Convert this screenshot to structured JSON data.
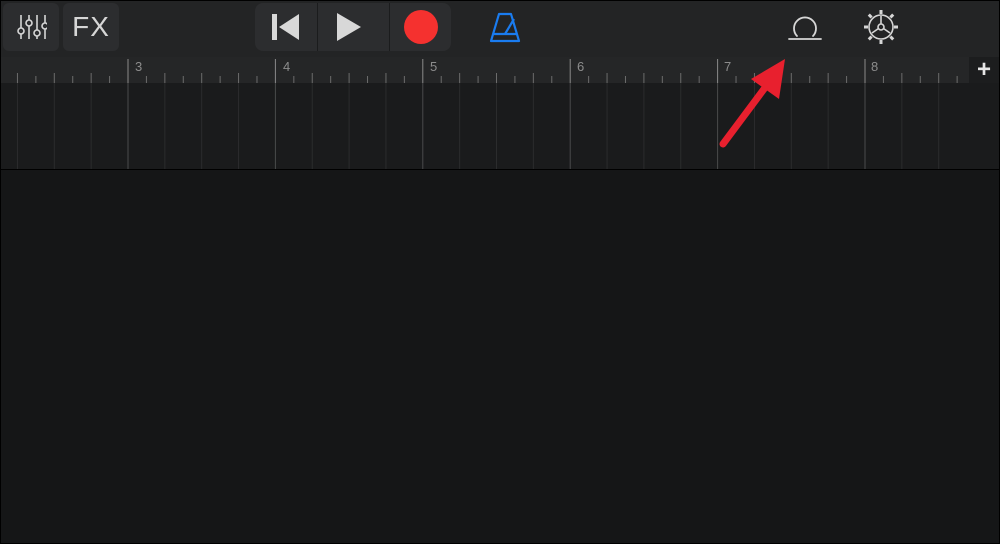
{
  "toolbar": {
    "mixer_icon": "mixer-sliders-icon",
    "fx_label": "FX",
    "transport": {
      "rewind_icon": "go-to-beginning-icon",
      "play_icon": "play-icon",
      "record_icon": "record-icon"
    },
    "metronome_icon": "metronome-icon",
    "loop_browser_icon": "loop-icon",
    "settings_icon": "gear-icon"
  },
  "ruler": {
    "bars": [
      "3",
      "4",
      "5",
      "6",
      "7",
      "8"
    ],
    "add_track_label": "+"
  },
  "colors": {
    "background": "#151617",
    "toolbar": "#232425",
    "record": "#f5312f",
    "metronome": "#1a7cf0",
    "annotation_arrow": "#e8202e"
  },
  "annotation": {
    "arrow_target": "loop-browser-button"
  }
}
